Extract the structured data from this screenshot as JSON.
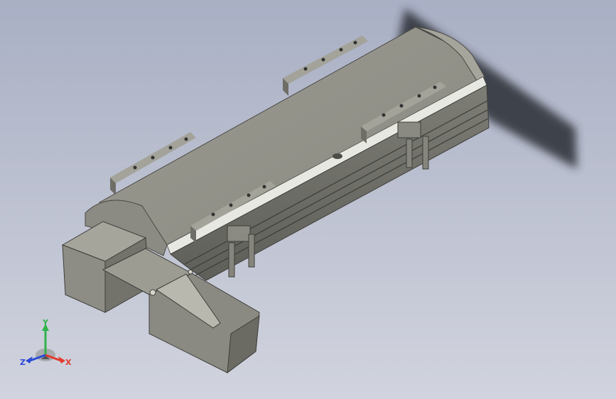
{
  "viewport": {
    "background_top_color": "#a9afc4",
    "background_bottom_color": "#d1d4de",
    "model_body_color": "#8f8f86",
    "model_dark_color": "#5e5e58",
    "model_light_color": "#b5b5ac",
    "shadow_color": "#2c2f36"
  },
  "triad": {
    "x_label": "X",
    "y_label": "Y",
    "z_label": "Z",
    "x_color": "#e23b2e",
    "y_color": "#2fb34a",
    "z_color": "#2c4bd6"
  },
  "icons": [
    "coordinate-triad-icon"
  ]
}
